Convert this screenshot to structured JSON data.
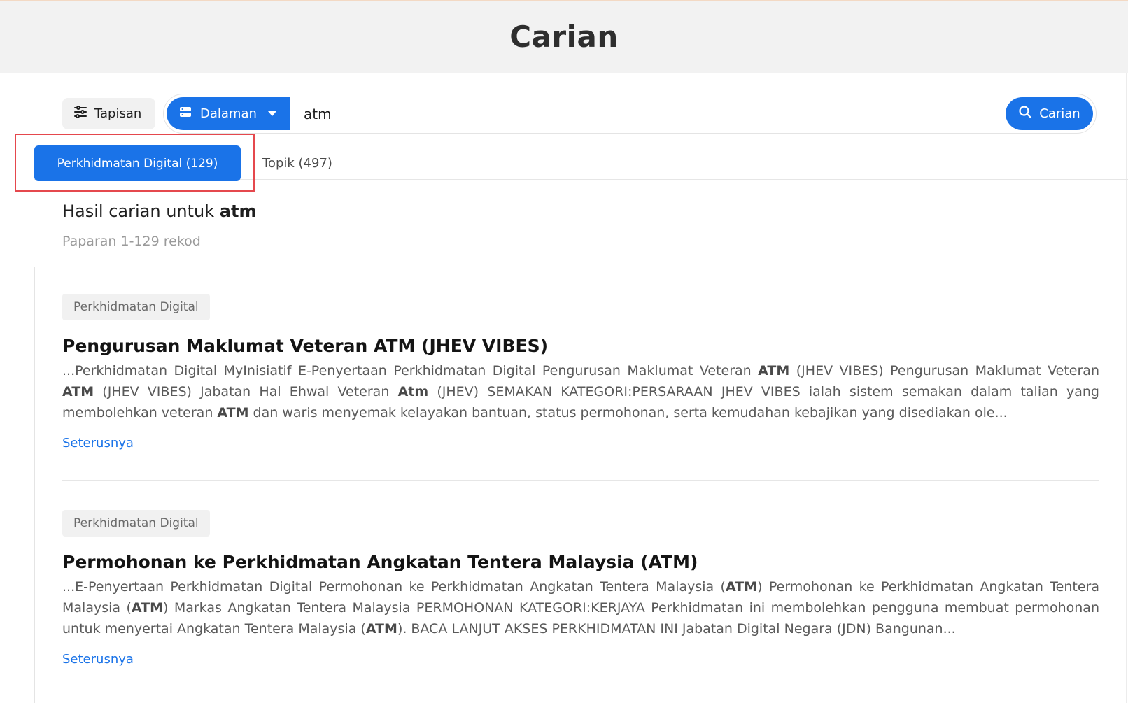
{
  "header": {
    "title": "Carian"
  },
  "search": {
    "filter_label": "Tapisan",
    "scope_label": "Dalaman",
    "query": "atm",
    "submit_label": "Carian"
  },
  "tabs": [
    {
      "label": "Perkhidmatan Digital (129)",
      "active": true
    },
    {
      "label": "Topik (497)",
      "active": false
    }
  ],
  "results_header": {
    "prefix": "Hasil carian untuk",
    "term": "atm",
    "count_text": "Paparan 1-129 rekod"
  },
  "results": [
    {
      "category": "Perkhidmatan Digital",
      "title": "Pengurusan Maklumat Veteran ATM (JHEV VIBES)",
      "snippet_parts": [
        {
          "t": "...Perkhidmatan Digital MyInisiatif E-Penyertaan Perkhidmatan Digital Pengurusan Maklumat Veteran ",
          "b": false
        },
        {
          "t": "ATM",
          "b": true
        },
        {
          "t": " (JHEV VIBES) Pengurusan Maklumat Veteran ",
          "b": false
        },
        {
          "t": "ATM",
          "b": true
        },
        {
          "t": " (JHEV VIBES) Jabatan Hal Ehwal Veteran ",
          "b": false
        },
        {
          "t": "Atm",
          "b": true
        },
        {
          "t": " (JHEV) SEMAKAN KATEGORI:PERSARAAN JHEV VIBES ialah sistem semakan dalam talian yang membolehkan veteran ",
          "b": false
        },
        {
          "t": "ATM",
          "b": true
        },
        {
          "t": " dan waris menyemak kelayakan bantuan, status permohonan, serta kemudahan kebajikan yang disediakan ole...",
          "b": false
        }
      ],
      "more_label": "Seterusnya"
    },
    {
      "category": "Perkhidmatan Digital",
      "title": "Permohonan ke Perkhidmatan Angkatan Tentera Malaysia (ATM)",
      "snippet_parts": [
        {
          "t": "...E-Penyertaan Perkhidmatan Digital Permohonan ke Perkhidmatan Angkatan Tentera Malaysia (",
          "b": false
        },
        {
          "t": "ATM",
          "b": true
        },
        {
          "t": ") Permohonan ke Perkhidmatan Angkatan Tentera Malaysia (",
          "b": false
        },
        {
          "t": "ATM",
          "b": true
        },
        {
          "t": ") Markas Angkatan Tentera Malaysia PERMOHONAN KATEGORI:KERJAYA Perkhidmatan ini membolehkan pengguna membuat permohonan untuk menyertai Angkatan Tentera Malaysia (",
          "b": false
        },
        {
          "t": "ATM",
          "b": true
        },
        {
          "t": "). BACA LANJUT AKSES PERKHIDMATAN INI Jabatan Digital Negara (JDN) Bangunan...",
          "b": false
        }
      ],
      "more_label": "Seterusnya"
    }
  ],
  "colors": {
    "accent": "#1a73e8",
    "highlight_box": "#e5484d",
    "header_bg": "#f2f2f2"
  },
  "icons": {
    "filter": "sliders-icon",
    "scope": "server-icon",
    "dropdown": "caret-down-icon",
    "search": "magnifier-icon"
  }
}
